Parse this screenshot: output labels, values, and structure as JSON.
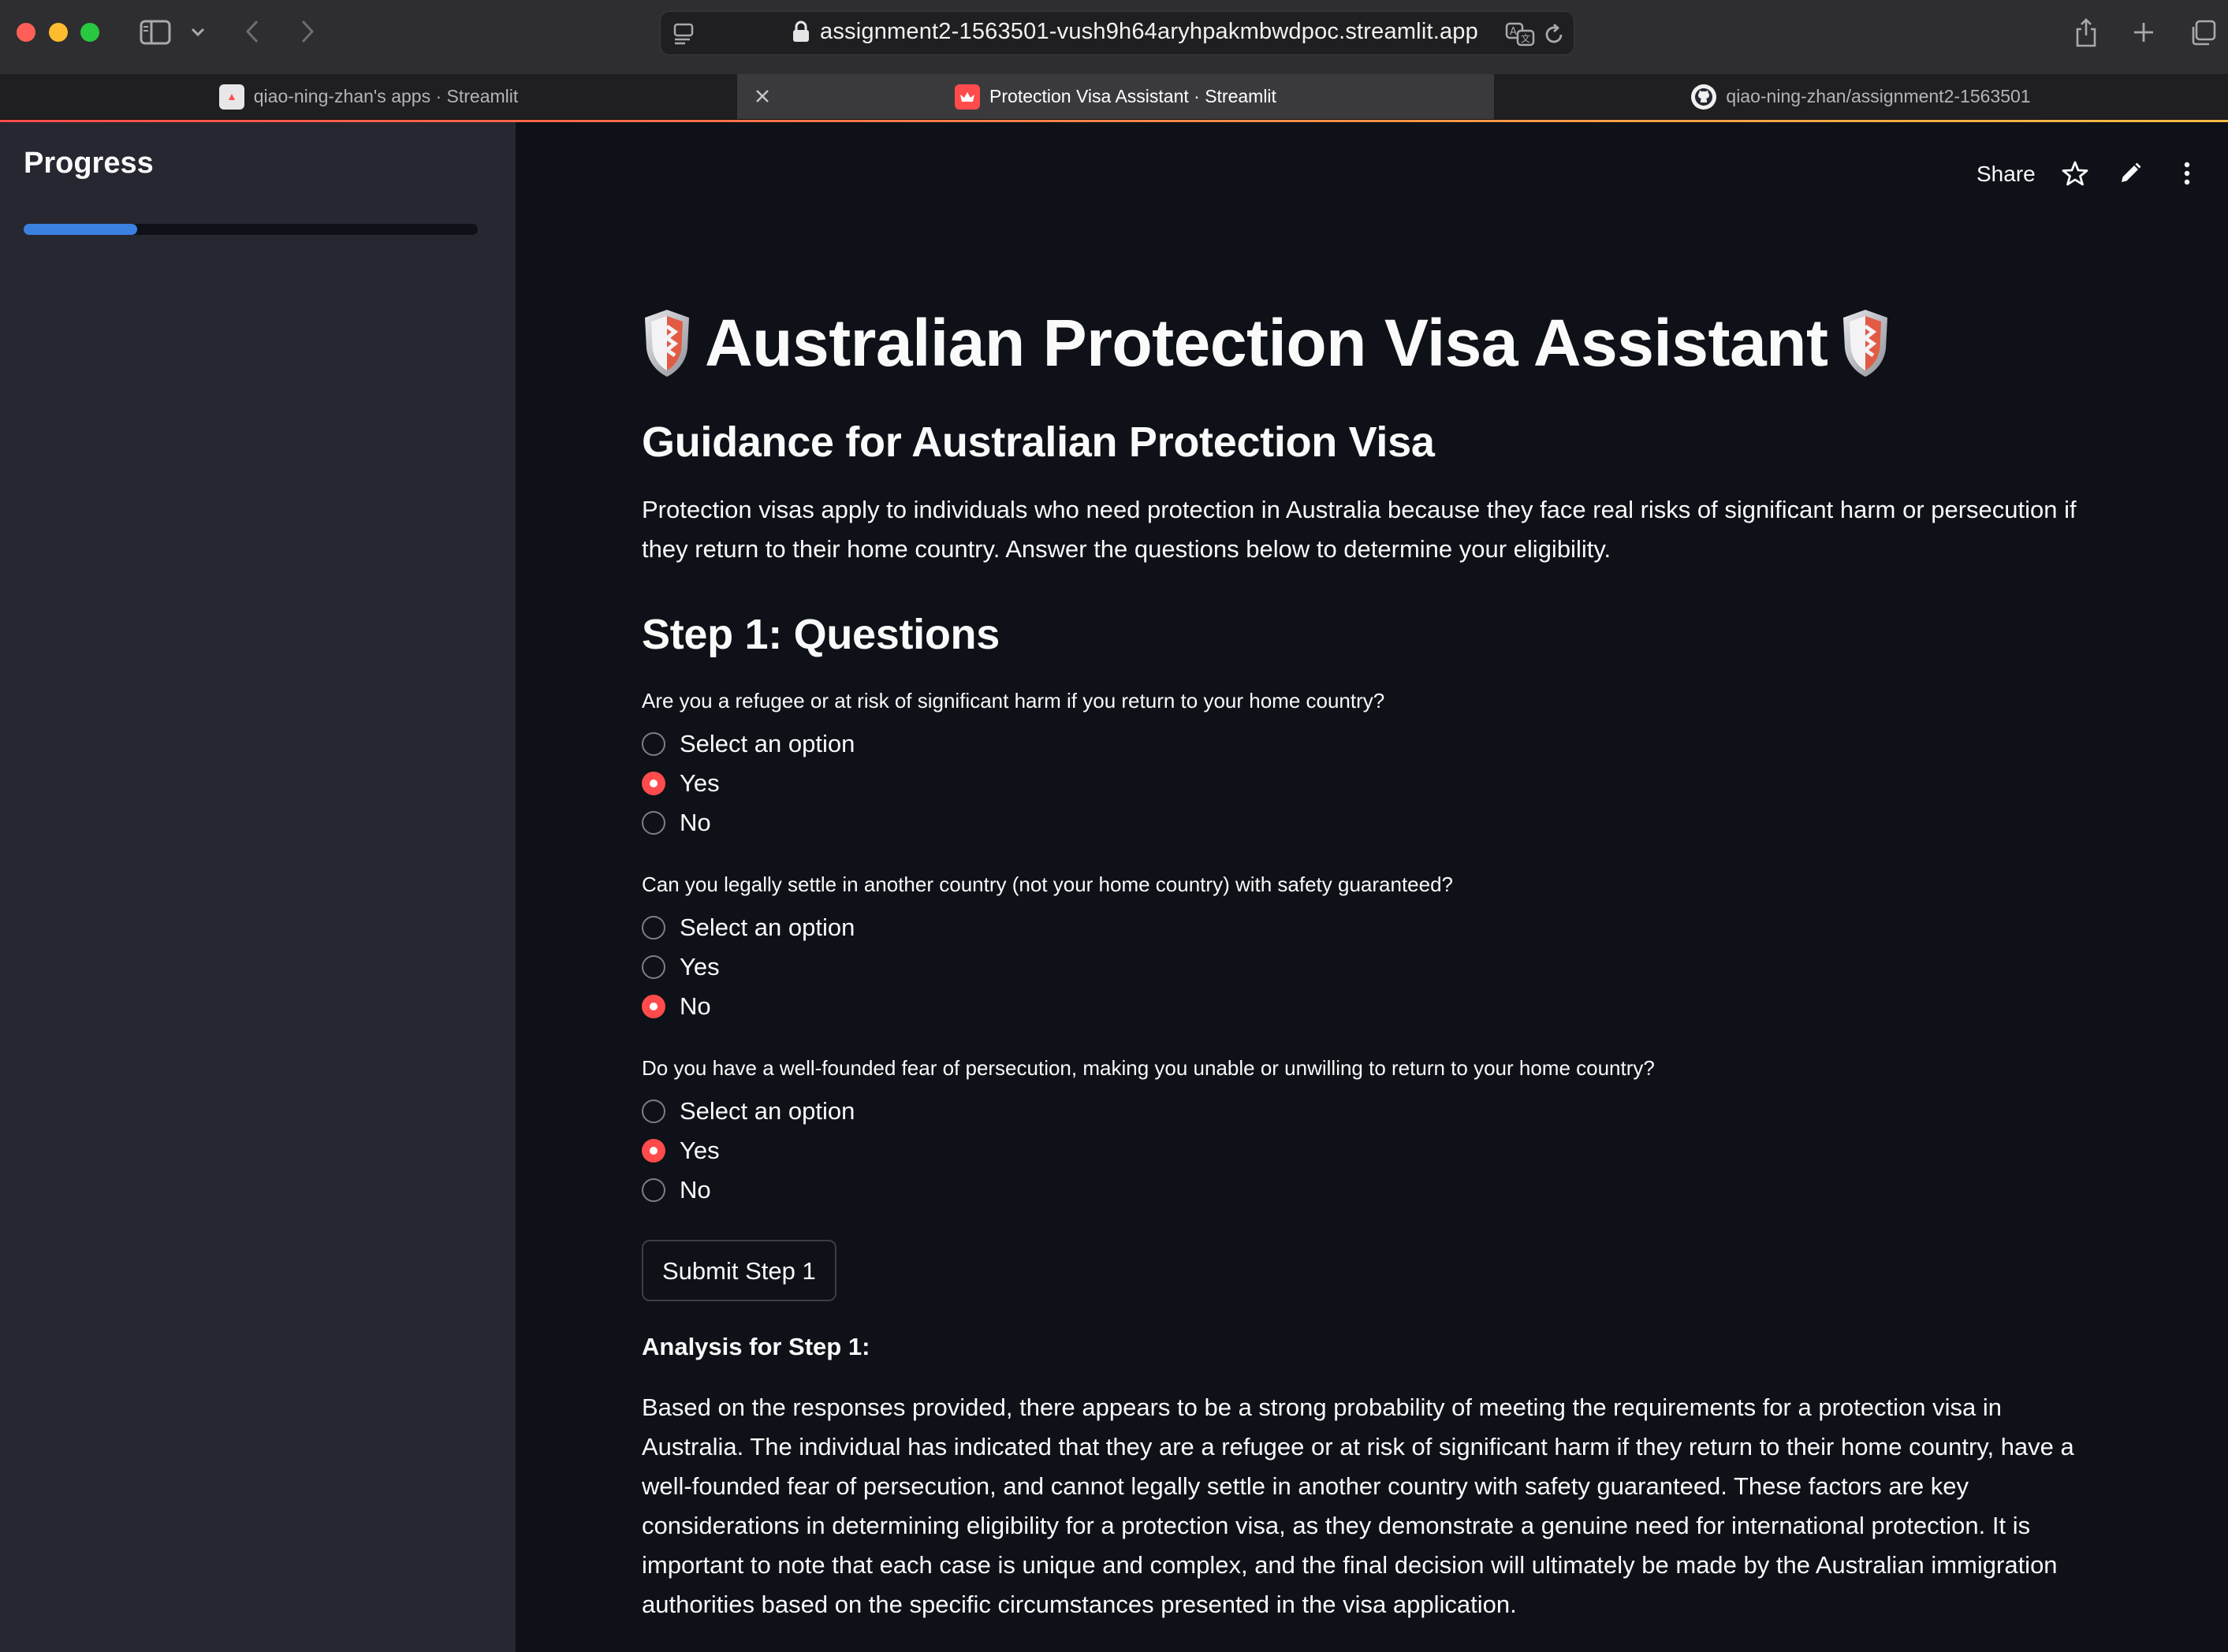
{
  "browser": {
    "url": "assignment2-1563501-vush9h64aryhpakmbwdpoc.streamlit.app",
    "tabs": [
      {
        "label": "qiao-ning-zhan's apps · Streamlit",
        "active": false
      },
      {
        "label": "Protection Visa Assistant · Streamlit",
        "active": true
      },
      {
        "label": "qiao-ning-zhan/assignment2-1563501",
        "active": false
      }
    ]
  },
  "sidebar": {
    "title": "Progress",
    "progress_fraction": 0.25
  },
  "toolbar": {
    "share_label": "Share"
  },
  "main": {
    "title": "Australian Protection Visa Assistant",
    "subtitle": "Guidance for Australian Protection Visa",
    "intro": "Protection visas apply to individuals who need protection in Australia because they face real risks of significant harm or persecution if they return to their home country. Answer the questions below to determine your eligibility.",
    "step_heading": "Step 1: Questions",
    "questions": [
      {
        "text": "Are you a refugee or at risk of significant harm if you return to your home country?",
        "options": [
          "Select an option",
          "Yes",
          "No"
        ],
        "selected": 1
      },
      {
        "text": "Can you legally settle in another country (not your home country) with safety guaranteed?",
        "options": [
          "Select an option",
          "Yes",
          "No"
        ],
        "selected": 2
      },
      {
        "text": "Do you have a well-founded fear of persecution, making you unable or unwilling to return to your home country?",
        "options": [
          "Select an option",
          "Yes",
          "No"
        ],
        "selected": 1
      }
    ],
    "submit_label": "Submit Step 1",
    "analysis_heading": "Analysis for Step 1:",
    "analysis_text": "Based on the responses provided, there appears to be a strong probability of meeting the requirements for a protection visa in Australia. The individual has indicated that they are a refugee or at risk of significant harm if they return to their home country, have a well-founded fear of persecution, and cannot legally settle in another country with safety guaranteed. These factors are key considerations in determining eligibility for a protection visa, as they demonstrate a genuine need for international protection. It is important to note that each case is unique and complex, and the final decision will ultimately be made by the Australian immigration authorities based on the specific circumstances presented in the visa application."
  },
  "colors": {
    "accent": "#ff4b4b",
    "progress": "#3b82e0",
    "background": "#0e1117",
    "sidebar": "#262730"
  },
  "icons": [
    "sidebar-toggle-icon",
    "chevron-down-icon",
    "back-icon",
    "forward-icon",
    "reader-icon",
    "lock-icon",
    "translate-icon",
    "reload-icon",
    "share-icon",
    "new-tab-icon",
    "tab-overview-icon",
    "close-icon",
    "star-icon",
    "pencil-icon",
    "more-vertical-icon",
    "shield-icon"
  ]
}
